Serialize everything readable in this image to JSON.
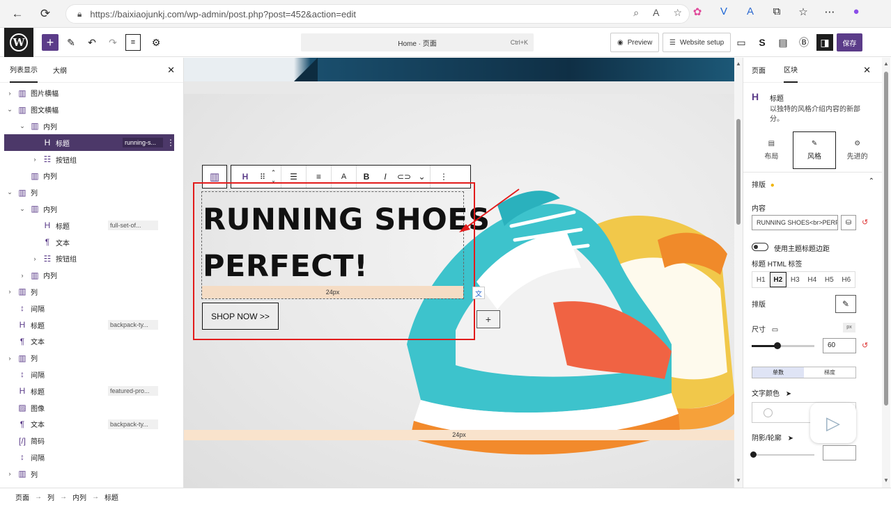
{
  "browser": {
    "url": "https://baixiaojunkj.com/wp-admin/post.php?post=452&action=edit"
  },
  "toolbar": {
    "command_center_label": "Home · 页面",
    "command_shortcut": "Ctrl+K",
    "preview_label": "Preview",
    "website_setup_label": "Website setup",
    "save_label": "保存"
  },
  "list_view": {
    "tab_list": "列表显示",
    "tab_outline": "大纲",
    "items": [
      {
        "label": "图片横幅",
        "anchor": ""
      },
      {
        "label": "图文横幅",
        "anchor": ""
      },
      {
        "label": "内列",
        "anchor": ""
      },
      {
        "label": "标题",
        "anchor": "running-s..."
      },
      {
        "label": "按钮组",
        "anchor": ""
      },
      {
        "label": "内列",
        "anchor": ""
      },
      {
        "label": "列",
        "anchor": ""
      },
      {
        "label": "内列",
        "anchor": ""
      },
      {
        "label": "标题",
        "anchor": "full-set-of..."
      },
      {
        "label": "文本",
        "anchor": ""
      },
      {
        "label": "按钮组",
        "anchor": ""
      },
      {
        "label": "内列",
        "anchor": ""
      },
      {
        "label": "列",
        "anchor": ""
      },
      {
        "label": "间隔",
        "anchor": ""
      },
      {
        "label": "标题",
        "anchor": "backpack-ty..."
      },
      {
        "label": "文本",
        "anchor": ""
      },
      {
        "label": "列",
        "anchor": ""
      },
      {
        "label": "间隔",
        "anchor": ""
      },
      {
        "label": "标题",
        "anchor": "featured-pro..."
      },
      {
        "label": "图像",
        "anchor": ""
      },
      {
        "label": "文本",
        "anchor": "backpack-ty..."
      },
      {
        "label": "简码",
        "anchor": ""
      },
      {
        "label": "间隔",
        "anchor": ""
      },
      {
        "label": "列",
        "anchor": ""
      }
    ]
  },
  "canvas": {
    "heading_line1": "RUNNING SHOES",
    "heading_line2": "PERFECT!",
    "spacer_label": "24px",
    "button_label": "SHOP NOW >>",
    "bottom_spacer_label": "24px"
  },
  "inspector": {
    "tab_page": "页面",
    "tab_block": "区块",
    "block_title": "标题",
    "block_description": "以独特的风格介绍内容的新部分。",
    "style_tabs": [
      "布局",
      "风格",
      "先进的"
    ],
    "typography_label": "排版",
    "content_label": "内容",
    "content_value": "RUNNING SHOES<br>PERFECT!",
    "use_theme_margin_label": "使用主题标题边距",
    "heading_tag_label": "标题 HTML 标签",
    "heading_tags": [
      "H1",
      "H2",
      "H3",
      "H4",
      "H5",
      "H6"
    ],
    "selected_tag": "H2",
    "typography_edit_label": "排版",
    "size_label": "尺寸",
    "size_unit": "px",
    "size_value": "60",
    "size_percent": 0.4,
    "fill_modes": [
      "单数",
      "梯度"
    ],
    "text_color_label": "文字颜色",
    "shadow_label": "阴影/轮廓"
  },
  "breadcrumb": [
    "页面",
    "列",
    "内列",
    "标题"
  ],
  "colors": {
    "accent": "#5b3c89",
    "selection_red": "#e21b1b",
    "spacer": "#f5dcc4"
  }
}
